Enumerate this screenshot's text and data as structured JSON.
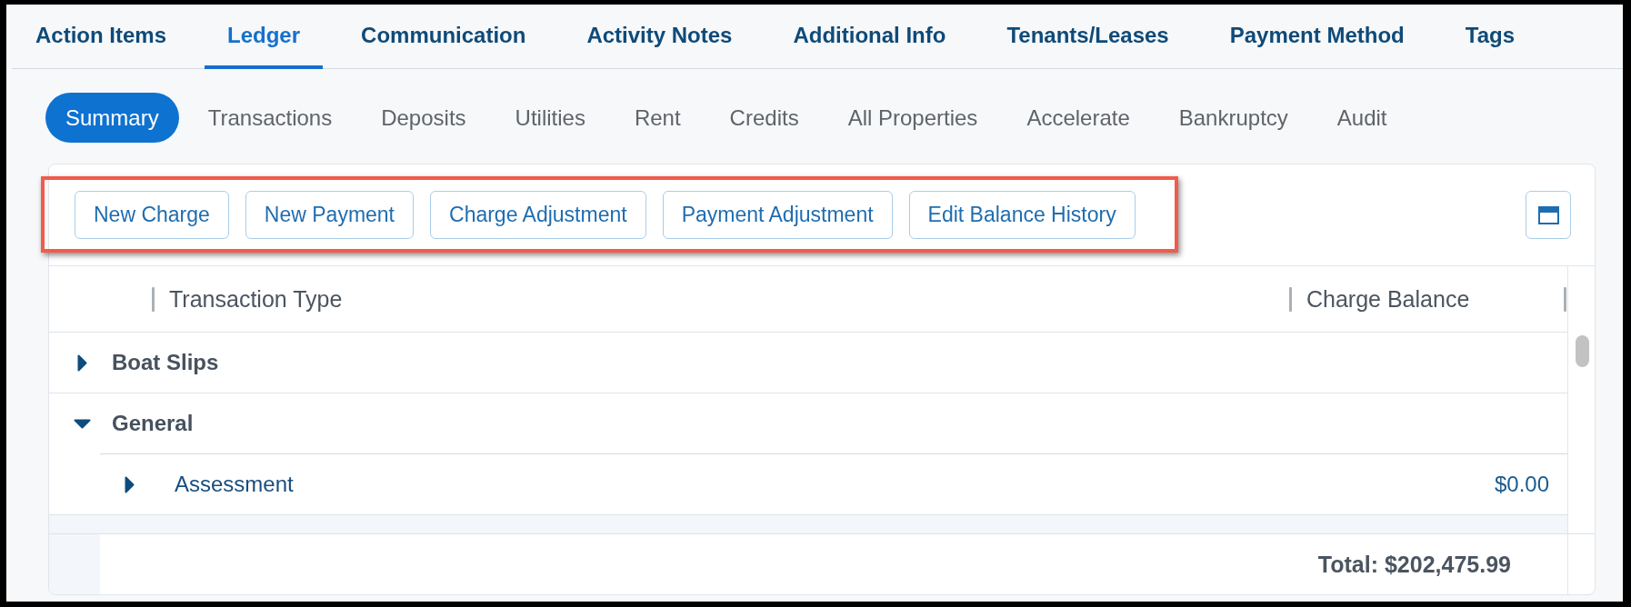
{
  "main_tabs": [
    {
      "label": "Action Items",
      "selected": false
    },
    {
      "label": "Ledger",
      "selected": true
    },
    {
      "label": "Communication",
      "selected": false
    },
    {
      "label": "Activity Notes",
      "selected": false
    },
    {
      "label": "Additional Info",
      "selected": false
    },
    {
      "label": "Tenants/Leases",
      "selected": false
    },
    {
      "label": "Payment Method",
      "selected": false
    },
    {
      "label": "Tags",
      "selected": false
    }
  ],
  "sub_tabs": [
    {
      "label": "Summary",
      "selected": true
    },
    {
      "label": "Transactions",
      "selected": false
    },
    {
      "label": "Deposits",
      "selected": false
    },
    {
      "label": "Utilities",
      "selected": false
    },
    {
      "label": "Rent",
      "selected": false
    },
    {
      "label": "Credits",
      "selected": false
    },
    {
      "label": "All Properties",
      "selected": false
    },
    {
      "label": "Accelerate",
      "selected": false
    },
    {
      "label": "Bankruptcy",
      "selected": false
    },
    {
      "label": "Audit",
      "selected": false
    }
  ],
  "toolbar": {
    "highlighted": true,
    "buttons": [
      "New Charge",
      "New Payment",
      "Charge Adjustment",
      "Payment Adjustment",
      "Edit Balance History"
    ]
  },
  "table": {
    "columns": [
      "Transaction Type",
      "Charge Balance"
    ],
    "rows": [
      {
        "label": "Boat Slips",
        "expanded": false
      },
      {
        "label": "General",
        "expanded": true,
        "children": [
          {
            "label": "Assessment",
            "expanded": false,
            "balance": "$0.00"
          }
        ]
      }
    ],
    "total": "Total: $202,475.99"
  }
}
